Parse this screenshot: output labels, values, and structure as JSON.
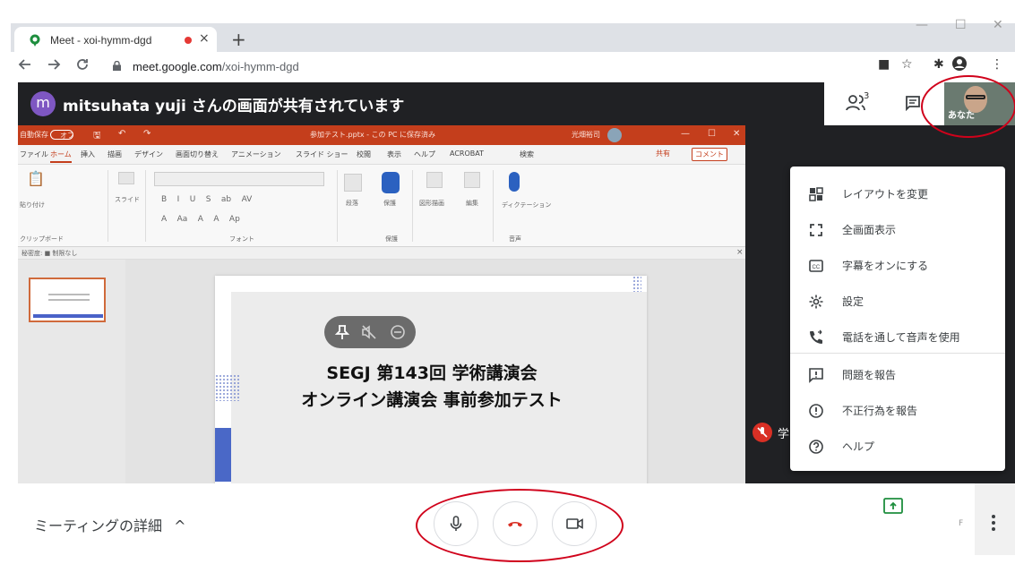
{
  "browser": {
    "tab_title": "Meet - xoi-hymm-dgd",
    "tab_close": "×",
    "new_tab": "+",
    "url_host": "meet.google.com",
    "url_path": "/xoi-hymm-dgd",
    "back_icon": "arrow-left-icon",
    "forward_icon": "arrow-right-icon",
    "reload_icon": "reload-icon"
  },
  "meet": {
    "presenter_initial": "m",
    "share_banner": "mitsuhata yuji さんの画面が共有されています",
    "people_count": "3",
    "self_label": "あなた",
    "participant_label_partial": "学",
    "meeting_details": "ミーティングの詳細",
    "bottom_small_text": "F",
    "accent_red": "#d93025"
  },
  "ppt": {
    "title_bar": "参加テスト.pptx - この PC に保存済み",
    "autosave_label": "自動保存",
    "autosave_state": "オフ",
    "user_name": "光畑裕司",
    "tabs": [
      "ファイル",
      "ホーム",
      "挿入",
      "描画",
      "デザイン",
      "画面切り替え",
      "アニメーション",
      "スライド ショー",
      "校閲",
      "表示",
      "ヘルプ",
      "ACROBAT",
      "検索"
    ],
    "active_tab": "ホーム",
    "share_btn": "共有",
    "comment_btn": "コメント",
    "ribbon": {
      "paste": "貼り付け",
      "clipboard": "クリップボード",
      "slide": "スライド",
      "font": "フォント",
      "paragraph": "段落",
      "protect": "保護",
      "protect2": "保護",
      "drawing": "図形描画",
      "edit": "編集",
      "dictation": "ディクテーション",
      "voice": "音声"
    },
    "status_bar": "秘密度: ■ 制限なし",
    "slide_line1": "SEGJ 第143回 学術講演会",
    "slide_line2": "オンライン講演会 事前参加テスト"
  },
  "menu": {
    "items": [
      {
        "label": "レイアウトを変更",
        "icon": "layout-icon"
      },
      {
        "label": "全画面表示",
        "icon": "fullscreen-icon"
      },
      {
        "label": "字幕をオンにする",
        "icon": "captions-icon"
      },
      {
        "label": "設定",
        "icon": "gear-icon"
      },
      {
        "label": "電話を通して音声を使用",
        "icon": "phone-icon"
      },
      {
        "label": "問題を報告",
        "icon": "report-issue-icon"
      },
      {
        "label": "不正行為を報告",
        "icon": "report-abuse-icon"
      },
      {
        "label": "ヘルプ",
        "icon": "help-icon"
      }
    ]
  }
}
